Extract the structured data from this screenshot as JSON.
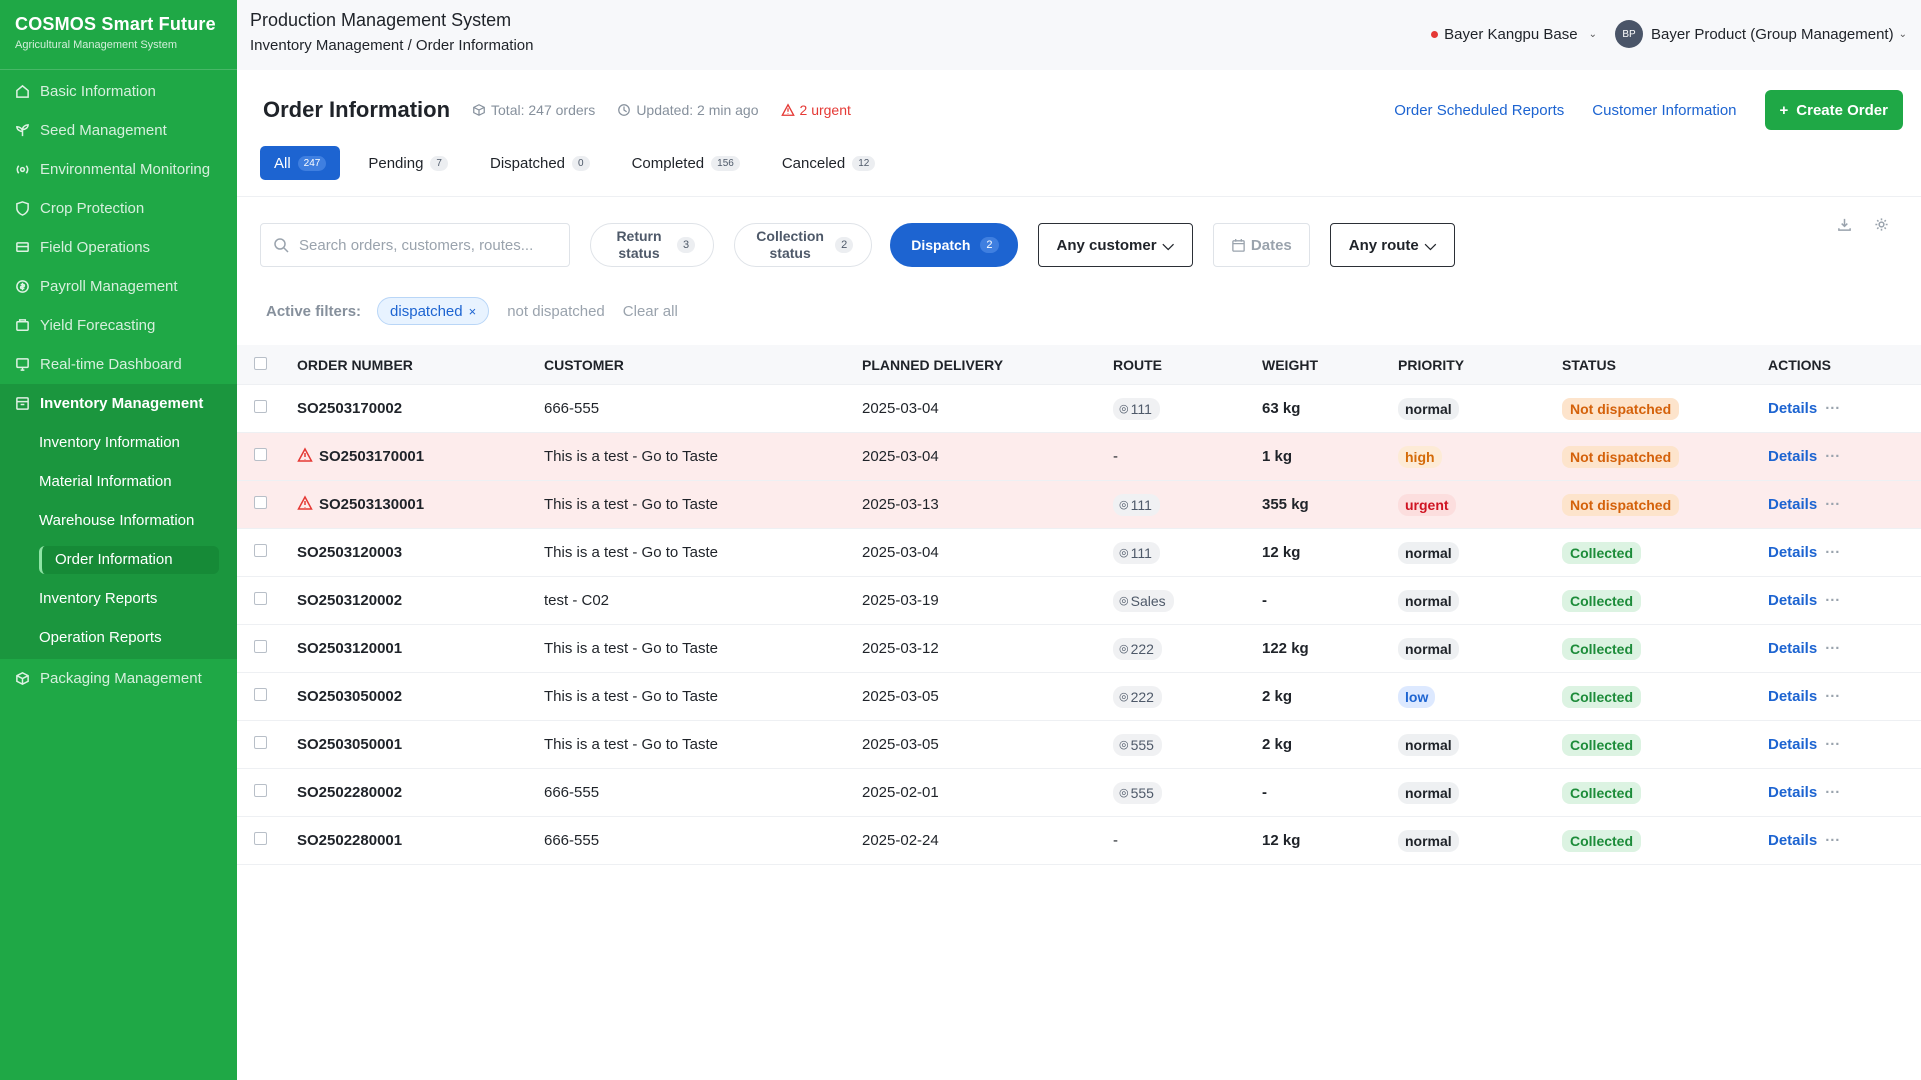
{
  "brand": {
    "title": "COSMOS Smart Future",
    "subtitle": "Agricultural Management System"
  },
  "sidebar": {
    "items": [
      {
        "label": "Basic Information",
        "icon": "home-icon"
      },
      {
        "label": "Seed Management",
        "icon": "seedling-icon"
      },
      {
        "label": "Environmental Monitoring",
        "icon": "sensor-icon"
      },
      {
        "label": "Crop Protection",
        "icon": "shield-icon"
      },
      {
        "label": "Field Operations",
        "icon": "tractor-icon"
      },
      {
        "label": "Payroll Management",
        "icon": "money-icon"
      },
      {
        "label": "Yield Forecasting",
        "icon": "chart-icon"
      },
      {
        "label": "Real-time Dashboard",
        "icon": "monitor-icon"
      },
      {
        "label": "Inventory Management",
        "icon": "inventory-icon"
      },
      {
        "label": "Packaging Management",
        "icon": "package-icon"
      }
    ],
    "sub_items": [
      {
        "label": "Inventory Information"
      },
      {
        "label": "Material Information"
      },
      {
        "label": "Warehouse Information"
      },
      {
        "label": "Order Information"
      },
      {
        "label": "Inventory Reports"
      },
      {
        "label": "Operation Reports"
      }
    ]
  },
  "topbar": {
    "app_title": "Production Management System",
    "breadcrumb": "Inventory Management / Order Information",
    "base": "Bayer Kangpu Base",
    "avatar": "BP",
    "user": "Bayer Product (Group Management)"
  },
  "header": {
    "title": "Order Information",
    "total": "Total: 247 orders",
    "updated": "Updated: 2 min ago",
    "urgent": "2 urgent",
    "link_reports": "Order Scheduled Reports",
    "link_customers": "Customer Information",
    "create": "Create Order"
  },
  "tabs": [
    {
      "label": "All",
      "count": "247"
    },
    {
      "label": "Pending",
      "count": "7"
    },
    {
      "label": "Dispatched",
      "count": "0"
    },
    {
      "label": "Completed",
      "count": "156"
    },
    {
      "label": "Canceled",
      "count": "12"
    }
  ],
  "filters": {
    "search_placeholder": "Search orders, customers, routes...",
    "return_label": "Return status",
    "return_count": "3",
    "collection_label": "Collection status",
    "collection_count": "2",
    "dispatch_label": "Dispatch",
    "dispatch_count": "2",
    "customer": "Any customer",
    "dates": "Dates",
    "route": "Any route"
  },
  "active_filters": {
    "label": "Active filters:",
    "chip": "dispatched",
    "muted": "not dispatched",
    "clear": "Clear all"
  },
  "table": {
    "headers": {
      "order": "ORDER NUMBER",
      "customer": "CUSTOMER",
      "date": "PLANNED DELIVERY",
      "route": "ROUTE",
      "weight": "WEIGHT",
      "priority": "PRIORITY",
      "status": "STATUS",
      "actions": "ACTIONS"
    },
    "details_label": "Details",
    "more_label": "···",
    "rows": [
      {
        "order": "SO2503170002",
        "customer": "666-555",
        "date": "2025-03-04",
        "route": "111",
        "weight": "63 kg",
        "priority": "normal",
        "status": "Not dispatched",
        "alert": false
      },
      {
        "order": "SO2503170001",
        "customer": "This is a test - Go to Taste",
        "date": "2025-03-04",
        "route": "-",
        "weight": "1 kg",
        "priority": "high",
        "status": "Not dispatched",
        "alert": true
      },
      {
        "order": "SO2503130001",
        "customer": "This is a test - Go to Taste",
        "date": "2025-03-13",
        "route": "111",
        "weight": "355 kg",
        "priority": "urgent",
        "status": "Not dispatched",
        "alert": true
      },
      {
        "order": "SO2503120003",
        "customer": "This is a test - Go to Taste",
        "date": "2025-03-04",
        "route": "111",
        "weight": "12 kg",
        "priority": "normal",
        "status": "Collected",
        "alert": false
      },
      {
        "order": "SO2503120002",
        "customer": "test - C02",
        "date": "2025-03-19",
        "route": "Sales",
        "weight": "-",
        "priority": "normal",
        "status": "Collected",
        "alert": false
      },
      {
        "order": "SO2503120001",
        "customer": "This is a test - Go to Taste",
        "date": "2025-03-12",
        "route": "222",
        "weight": "122 kg",
        "priority": "normal",
        "status": "Collected",
        "alert": false
      },
      {
        "order": "SO2503050002",
        "customer": "This is a test - Go to Taste",
        "date": "2025-03-05",
        "route": "222",
        "weight": "2 kg",
        "priority": "low",
        "status": "Collected",
        "alert": false
      },
      {
        "order": "SO2503050001",
        "customer": "This is a test - Go to Taste",
        "date": "2025-03-05",
        "route": "555",
        "weight": "2 kg",
        "priority": "normal",
        "status": "Collected",
        "alert": false
      },
      {
        "order": "SO2502280002",
        "customer": "666-555",
        "date": "2025-02-01",
        "route": "555",
        "weight": "-",
        "priority": "normal",
        "status": "Collected",
        "alert": false
      },
      {
        "order": "SO2502280001",
        "customer": "666-555",
        "date": "2025-02-24",
        "route": "-",
        "weight": "12 kg",
        "priority": "normal",
        "status": "Collected",
        "alert": false
      }
    ]
  },
  "colors": {
    "brand_green": "#1fa846",
    "primary_blue": "#1d64d1",
    "urgent_red": "#e53935",
    "alert_row": "#fdecec"
  }
}
